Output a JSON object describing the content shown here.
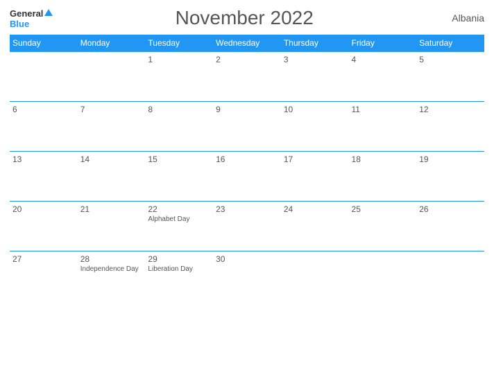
{
  "header": {
    "logo_general": "General",
    "logo_blue": "Blue",
    "title": "November 2022",
    "country": "Albania"
  },
  "weekdays": [
    "Sunday",
    "Monday",
    "Tuesday",
    "Wednesday",
    "Thursday",
    "Friday",
    "Saturday"
  ],
  "weeks": [
    [
      {
        "day": "",
        "empty": true
      },
      {
        "day": "",
        "empty": true
      },
      {
        "day": "1",
        "holiday": ""
      },
      {
        "day": "2",
        "holiday": ""
      },
      {
        "day": "3",
        "holiday": ""
      },
      {
        "day": "4",
        "holiday": ""
      },
      {
        "day": "5",
        "holiday": ""
      }
    ],
    [
      {
        "day": "6",
        "holiday": ""
      },
      {
        "day": "7",
        "holiday": ""
      },
      {
        "day": "8",
        "holiday": ""
      },
      {
        "day": "9",
        "holiday": ""
      },
      {
        "day": "10",
        "holiday": ""
      },
      {
        "day": "11",
        "holiday": ""
      },
      {
        "day": "12",
        "holiday": ""
      }
    ],
    [
      {
        "day": "13",
        "holiday": ""
      },
      {
        "day": "14",
        "holiday": ""
      },
      {
        "day": "15",
        "holiday": ""
      },
      {
        "day": "16",
        "holiday": ""
      },
      {
        "day": "17",
        "holiday": ""
      },
      {
        "day": "18",
        "holiday": ""
      },
      {
        "day": "19",
        "holiday": ""
      }
    ],
    [
      {
        "day": "20",
        "holiday": ""
      },
      {
        "day": "21",
        "holiday": ""
      },
      {
        "day": "22",
        "holiday": "Alphabet Day"
      },
      {
        "day": "23",
        "holiday": ""
      },
      {
        "day": "24",
        "holiday": ""
      },
      {
        "day": "25",
        "holiday": ""
      },
      {
        "day": "26",
        "holiday": ""
      }
    ],
    [
      {
        "day": "27",
        "holiday": ""
      },
      {
        "day": "28",
        "holiday": "Independence Day"
      },
      {
        "day": "29",
        "holiday": "Liberation Day"
      },
      {
        "day": "30",
        "holiday": ""
      },
      {
        "day": "",
        "empty": true
      },
      {
        "day": "",
        "empty": true
      },
      {
        "day": "",
        "empty": true
      }
    ]
  ]
}
